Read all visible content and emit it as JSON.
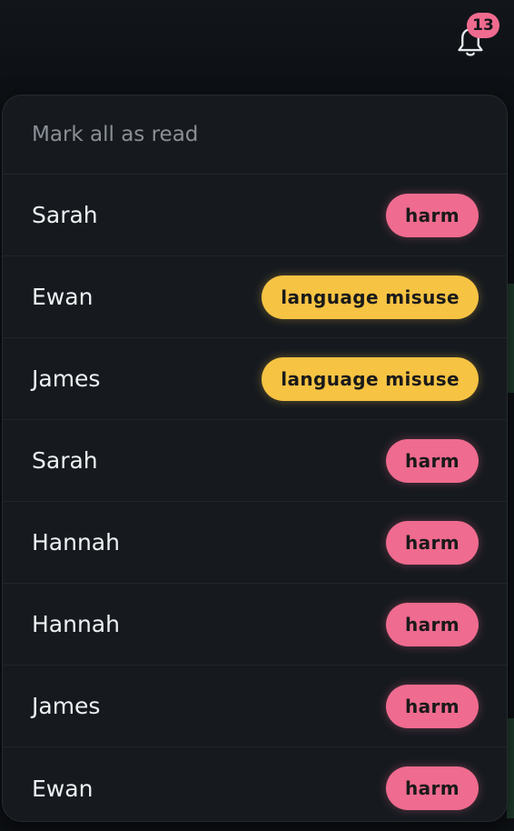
{
  "notifications": {
    "badge_count": "13",
    "mark_all_label": "Mark all as read",
    "items": [
      {
        "name": "Sarah",
        "tag": "harm",
        "kind": "harm"
      },
      {
        "name": "Ewan",
        "tag": "language misuse",
        "kind": "lang"
      },
      {
        "name": "James",
        "tag": "language misuse",
        "kind": "lang"
      },
      {
        "name": "Sarah",
        "tag": "harm",
        "kind": "harm"
      },
      {
        "name": "Hannah",
        "tag": "harm",
        "kind": "harm"
      },
      {
        "name": "Hannah",
        "tag": "harm",
        "kind": "harm"
      },
      {
        "name": "James",
        "tag": "harm",
        "kind": "harm"
      },
      {
        "name": "Ewan",
        "tag": "harm",
        "kind": "harm"
      }
    ]
  },
  "colors": {
    "harm": "#ef6b8f",
    "language_misuse": "#f6c343",
    "panel": "#161a1f",
    "background": "#0d1014"
  },
  "icons": {
    "bell": "bell-icon"
  }
}
